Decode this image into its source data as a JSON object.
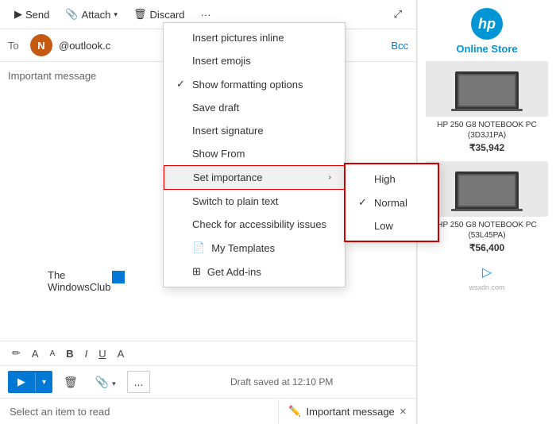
{
  "toolbar": {
    "send_label": "Send",
    "attach_label": "Attach",
    "discard_label": "Discard",
    "more_label": "..."
  },
  "compose": {
    "to_label": "To",
    "avatar_initial": "N",
    "email_partial": "@outlook.c",
    "bcc_label": "Bcc",
    "subject": "Important message"
  },
  "dropdown": {
    "items": [
      {
        "id": "insert-pictures",
        "label": "Insert pictures inline",
        "icon": "",
        "hasCheck": false
      },
      {
        "id": "insert-emojis",
        "label": "Insert emojis",
        "icon": "",
        "hasCheck": false
      },
      {
        "id": "show-formatting",
        "label": "Show formatting options",
        "icon": "",
        "hasCheck": true
      },
      {
        "id": "save-draft",
        "label": "Save draft",
        "icon": "",
        "hasCheck": false
      },
      {
        "id": "insert-signature",
        "label": "Insert signature",
        "icon": "",
        "hasCheck": false
      },
      {
        "id": "show-from",
        "label": "Show From",
        "icon": "",
        "hasCheck": false
      },
      {
        "id": "set-importance",
        "label": "Set importance",
        "icon": "",
        "hasCheck": false,
        "hasSubmenu": true
      },
      {
        "id": "switch-plain",
        "label": "Switch to plain text",
        "icon": "",
        "hasCheck": false
      },
      {
        "id": "accessibility",
        "label": "Check for accessibility issues",
        "icon": "",
        "hasCheck": false
      },
      {
        "id": "my-templates",
        "label": "My Templates",
        "icon": "📄",
        "hasCheck": false
      },
      {
        "id": "get-addins",
        "label": "Get Add-ins",
        "icon": "⊞",
        "hasCheck": false
      }
    ],
    "submenu": {
      "items": [
        {
          "id": "high",
          "label": "High",
          "hasCheck": false
        },
        {
          "id": "normal",
          "label": "Normal",
          "hasCheck": true
        },
        {
          "id": "low",
          "label": "Low",
          "hasCheck": false
        }
      ]
    }
  },
  "action_bar": {
    "draft_status": "Draft saved at 12:10 PM",
    "more_label": "..."
  },
  "bottom_bar": {
    "select_label": "Select an item to read",
    "tab_label": "Important message",
    "tab_icon": "✏️"
  },
  "ad": {
    "logo_text": "hp",
    "store_name": "Online Store",
    "product1": {
      "name": "HP 250 G8 NOTEBOOK PC (3D3J1PA)",
      "price": "₹35,942"
    },
    "product2": {
      "name": "HP 250 G8 NOTEBOOK PC (53L45PA)",
      "price": "₹56,400"
    },
    "watermark": "wsxdn.com"
  },
  "wc_logo": {
    "line1": "The",
    "line2": "WindowsClub"
  }
}
